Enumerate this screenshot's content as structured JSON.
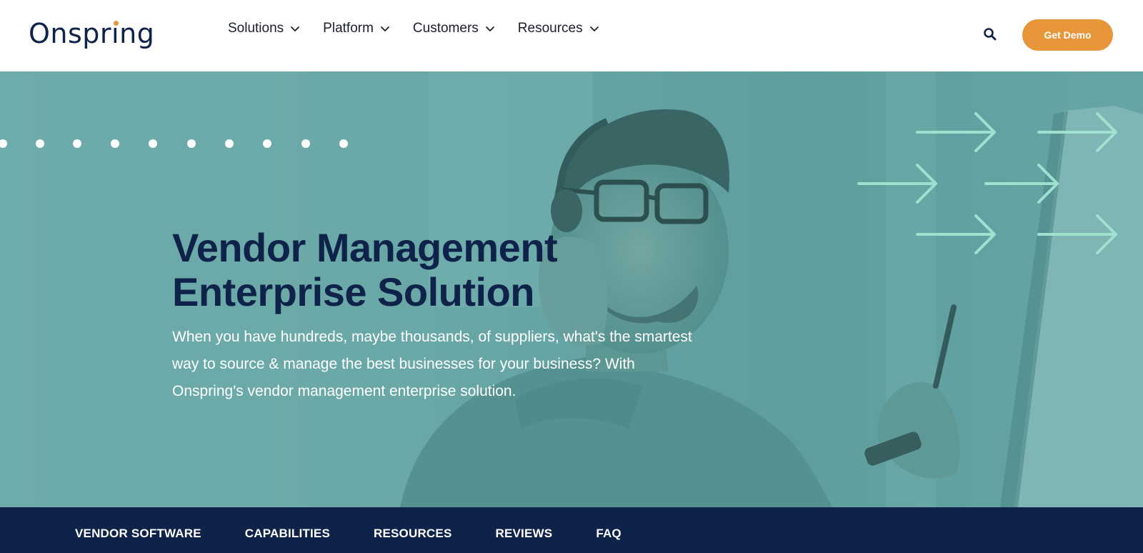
{
  "header": {
    "logo_text": "Onspring",
    "logo_prefix": "Onspr",
    "logo_i": "i",
    "logo_suffix": "ng",
    "nav": [
      {
        "label": "Solutions"
      },
      {
        "label": "Platform"
      },
      {
        "label": "Customers"
      },
      {
        "label": "Resources"
      }
    ],
    "search_icon": "search-icon",
    "demo_button": "Get Demo"
  },
  "hero": {
    "title": "Vendor Management Enterprise Solution",
    "subtitle": "When you have hundreds, maybe thousands, of suppliers, what's the smartest way to source & manage the best businesses for your business? With Onspring's vendor management enterprise solution.",
    "background_image": "man-with-headset-holding-pen-at-monitor",
    "decorations": [
      "dotted-line",
      "arrow-pattern"
    ]
  },
  "subnav": {
    "items": [
      {
        "label": "VENDOR SOFTWARE"
      },
      {
        "label": "CAPABILITIES"
      },
      {
        "label": "RESOURCES"
      },
      {
        "label": "REVIEWS"
      },
      {
        "label": "FAQ"
      }
    ]
  },
  "colors": {
    "navy": "#0f2249",
    "orange": "#e8963a",
    "teal_overlay": "#6aa6a6",
    "arrow_mint": "#9fe0cf"
  }
}
